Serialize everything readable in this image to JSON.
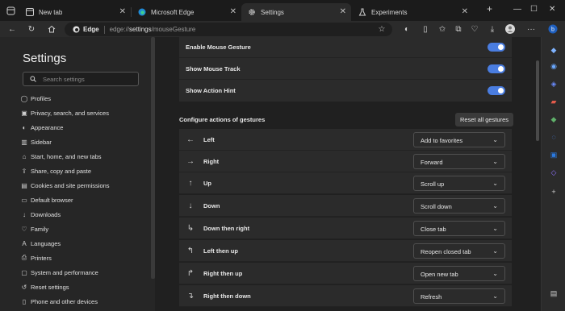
{
  "tabs": [
    {
      "label": "New tab",
      "icon": "new-tab-page-icon"
    },
    {
      "label": "Microsoft Edge",
      "icon": "edge-logo-icon"
    },
    {
      "label": "Settings",
      "icon": "gear-icon"
    },
    {
      "label": "Experiments",
      "icon": "flask-icon"
    }
  ],
  "toolbar": {
    "brand": "Edge",
    "url_prefix": "edge://",
    "url_host": "settings",
    "url_path": "/mouseGesture"
  },
  "sidebar": {
    "title": "Settings",
    "search_placeholder": "Search settings",
    "items": [
      {
        "label": "Profiles",
        "icon": "profile-icon"
      },
      {
        "label": "Privacy, search, and services",
        "icon": "lock-icon"
      },
      {
        "label": "Appearance",
        "icon": "appearance-icon"
      },
      {
        "label": "Sidebar",
        "icon": "sidebar-icon"
      },
      {
        "label": "Start, home, and new tabs",
        "icon": "home-icon"
      },
      {
        "label": "Share, copy and paste",
        "icon": "share-icon"
      },
      {
        "label": "Cookies and site permissions",
        "icon": "cookie-icon"
      },
      {
        "label": "Default browser",
        "icon": "browser-icon"
      },
      {
        "label": "Downloads",
        "icon": "download-icon"
      },
      {
        "label": "Family",
        "icon": "family-icon"
      },
      {
        "label": "Languages",
        "icon": "language-icon"
      },
      {
        "label": "Printers",
        "icon": "printer-icon"
      },
      {
        "label": "System and performance",
        "icon": "system-icon"
      },
      {
        "label": "Reset settings",
        "icon": "reset-icon"
      },
      {
        "label": "Phone and other devices",
        "icon": "phone-icon"
      }
    ]
  },
  "main": {
    "toggles": [
      {
        "label": "Enable Mouse Gesture",
        "on": true
      },
      {
        "label": "Show Mouse Track",
        "on": true
      },
      {
        "label": "Show Action Hint",
        "on": true
      }
    ],
    "section_title": "Configure actions of gestures",
    "reset_label": "Reset all gestures",
    "gestures": [
      {
        "label": "Left",
        "arrow": "←",
        "action": "Add to favorites"
      },
      {
        "label": "Right",
        "arrow": "→",
        "action": "Forward"
      },
      {
        "label": "Up",
        "arrow": "↑",
        "action": "Scroll up"
      },
      {
        "label": "Down",
        "arrow": "↓",
        "action": "Scroll down"
      },
      {
        "label": "Down then right",
        "arrow": "↳",
        "action": "Close tab"
      },
      {
        "label": "Left then up",
        "arrow": "↰",
        "action": "Reopen closed tab"
      },
      {
        "label": "Right then up",
        "arrow": "↱",
        "action": "Open new tab"
      },
      {
        "label": "Right then down",
        "arrow": "↴",
        "action": "Refresh"
      }
    ]
  },
  "colors": {
    "accent": "#4a7de0",
    "background": "#202020",
    "card": "#2b2b2b"
  }
}
